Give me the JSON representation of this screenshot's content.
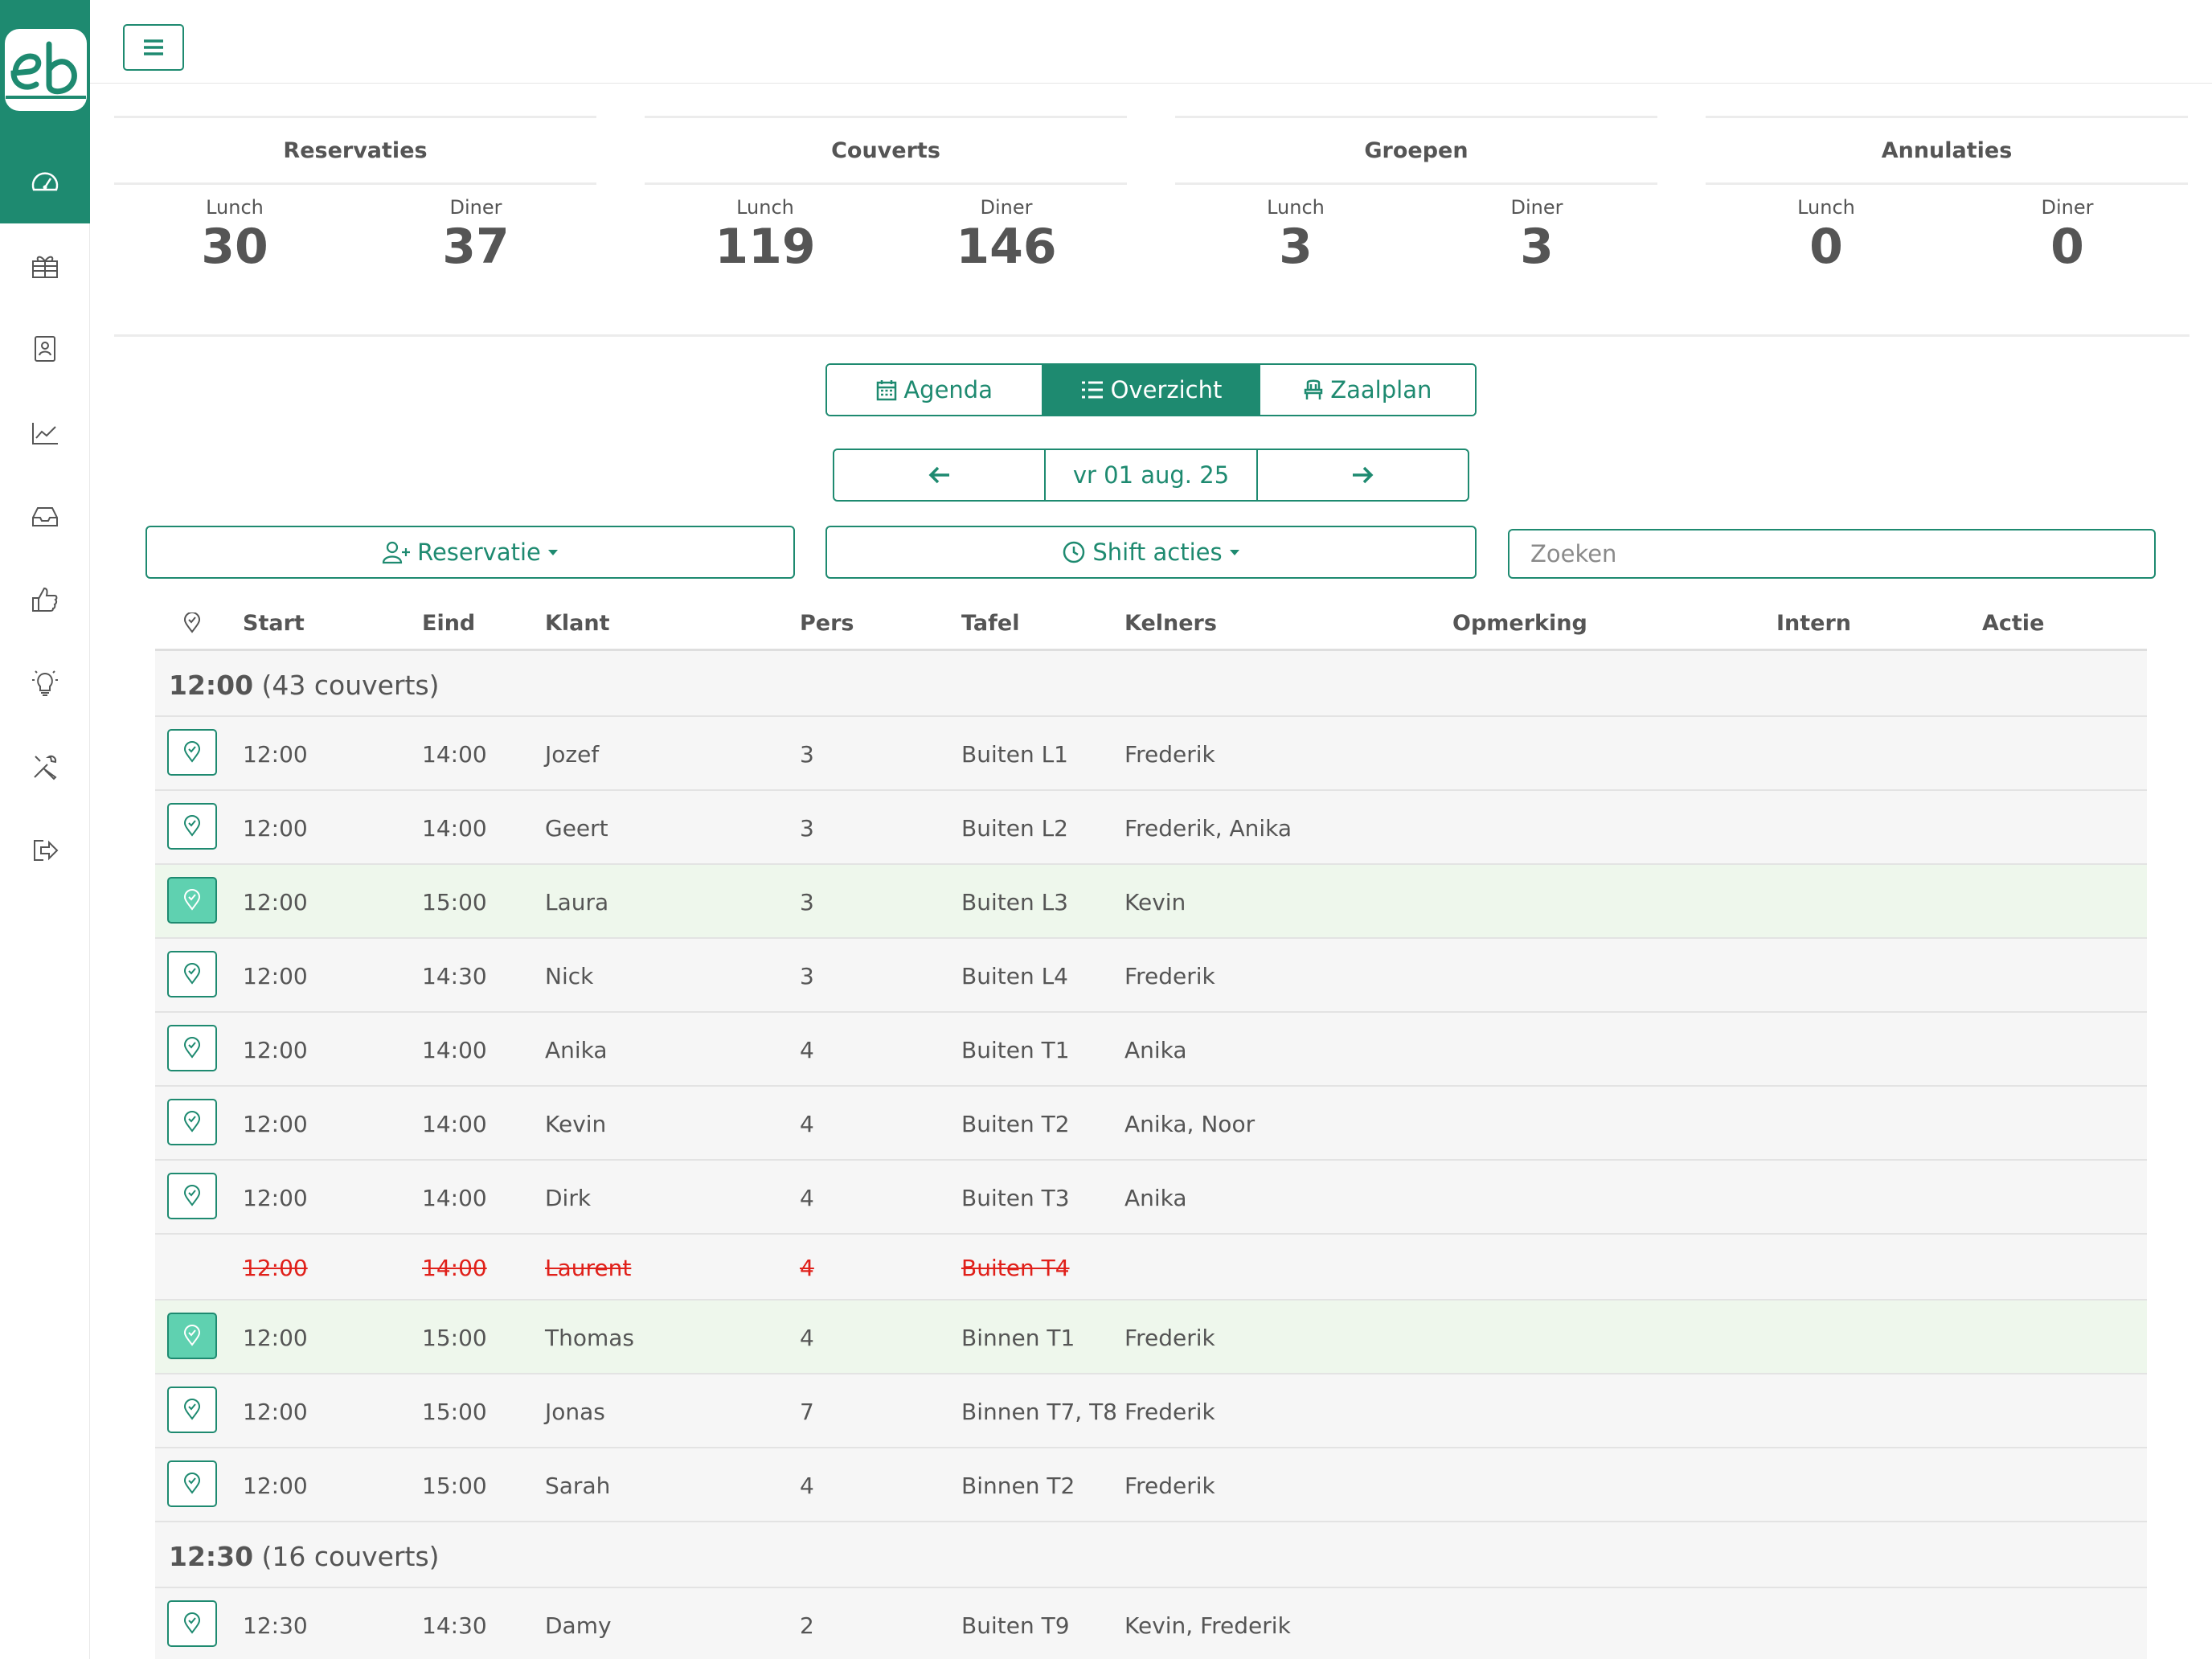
{
  "app": {
    "logo_text": "eb",
    "colors": {
      "brand": "#1e8a70",
      "seated_row": "#eef7ec",
      "seated_pin": "#5fd1b0",
      "cancelled": "#e0201a"
    },
    "sidebar_icons": [
      "dashboard-icon",
      "gift-icon",
      "contacts-icon",
      "chart-icon",
      "inbox-icon",
      "thumbs-up-icon",
      "lightbulb-icon",
      "tools-icon",
      "logout-icon"
    ]
  },
  "stats": [
    {
      "title": "Reservaties",
      "lunch_label": "Lunch",
      "lunch": "30",
      "diner_label": "Diner",
      "diner": "37"
    },
    {
      "title": "Couverts",
      "lunch_label": "Lunch",
      "lunch": "119",
      "diner_label": "Diner",
      "diner": "146"
    },
    {
      "title": "Groepen",
      "lunch_label": "Lunch",
      "lunch": "3",
      "diner_label": "Diner",
      "diner": "3"
    },
    {
      "title": "Annulaties",
      "lunch_label": "Lunch",
      "lunch": "0",
      "diner_label": "Diner",
      "diner": "0"
    }
  ],
  "views": {
    "agenda": "Agenda",
    "overzicht": "Overzicht",
    "zaalplan": "Zaalplan",
    "active": "overzicht"
  },
  "date_nav": {
    "date": "vr 01 aug. 25"
  },
  "actions": {
    "reservatie": "Reservatie",
    "shift": "Shift acties"
  },
  "search": {
    "placeholder": "Zoeken"
  },
  "table": {
    "headers": {
      "start": "Start",
      "eind": "Eind",
      "klant": "Klant",
      "pers": "Pers",
      "tafel": "Tafel",
      "kelners": "Kelners",
      "opmerking": "Opmerking",
      "intern": "Intern",
      "actie": "Actie"
    },
    "groups": [
      {
        "time": "12:00",
        "couverts": "(43 couverts)",
        "rows": [
          {
            "start": "12:00",
            "eind": "14:00",
            "klant": "Jozef",
            "pers": "3",
            "tafel": "Buiten L1",
            "kelners": "Frederik",
            "status": "normal"
          },
          {
            "start": "12:00",
            "eind": "14:00",
            "klant": "Geert",
            "pers": "3",
            "tafel": "Buiten L2",
            "kelners": "Frederik, Anika",
            "status": "normal"
          },
          {
            "start": "12:00",
            "eind": "15:00",
            "klant": "Laura",
            "pers": "3",
            "tafel": "Buiten L3",
            "kelners": "Kevin",
            "status": "seated"
          },
          {
            "start": "12:00",
            "eind": "14:30",
            "klant": "Nick",
            "pers": "3",
            "tafel": "Buiten L4",
            "kelners": "Frederik",
            "status": "normal"
          },
          {
            "start": "12:00",
            "eind": "14:00",
            "klant": "Anika",
            "pers": "4",
            "tafel": "Buiten T1",
            "kelners": "Anika",
            "status": "normal"
          },
          {
            "start": "12:00",
            "eind": "14:00",
            "klant": "Kevin",
            "pers": "4",
            "tafel": "Buiten T2",
            "kelners": "Anika, Noor",
            "status": "normal"
          },
          {
            "start": "12:00",
            "eind": "14:00",
            "klant": "Dirk",
            "pers": "4",
            "tafel": "Buiten T3",
            "kelners": "Anika",
            "status": "normal"
          },
          {
            "start": "12:00",
            "eind": "14:00",
            "klant": "Laurent",
            "pers": "4",
            "tafel": "Buiten T4",
            "kelners": "",
            "status": "cancelled"
          },
          {
            "start": "12:00",
            "eind": "15:00",
            "klant": "Thomas",
            "pers": "4",
            "tafel": "Binnen T1",
            "kelners": "Frederik",
            "status": "seated"
          },
          {
            "start": "12:00",
            "eind": "15:00",
            "klant": "Jonas",
            "pers": "7",
            "tafel": "Binnen T7, T8",
            "kelners": "Frederik",
            "status": "normal"
          },
          {
            "start": "12:00",
            "eind": "15:00",
            "klant": "Sarah",
            "pers": "4",
            "tafel": "Binnen T2",
            "kelners": "Frederik",
            "status": "normal"
          }
        ]
      },
      {
        "time": "12:30",
        "couverts": "(16 couverts)",
        "rows": [
          {
            "start": "12:30",
            "eind": "14:30",
            "klant": "Damy",
            "pers": "2",
            "tafel": "Buiten T9",
            "kelners": "Kevin, Frederik",
            "status": "normal"
          }
        ]
      }
    ]
  }
}
